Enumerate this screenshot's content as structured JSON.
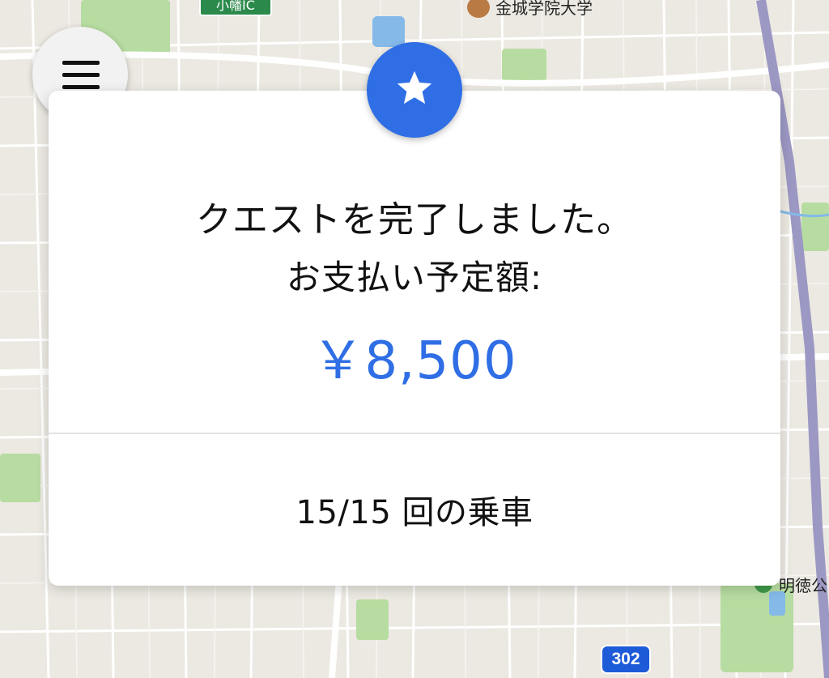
{
  "map": {
    "ic_sign": "小幡IC",
    "university_label": "金城学院大学",
    "park_label": "明徳公",
    "route_number": "302",
    "colors": {
      "land": "#ece9e2",
      "block": "#f6f3ee",
      "road": "#ffffff",
      "highway": "#9c98c4",
      "park": "#b7dca1",
      "river": "#84b9e8"
    }
  },
  "menu": {
    "icon": "hamburger-menu-icon"
  },
  "badge": {
    "icon": "star-icon",
    "color": "#2f6ee5"
  },
  "quest": {
    "title": "クエストを完了しました。",
    "payment_label": "お支払い予定額:",
    "amount": "￥8,500",
    "rides": "15/15 回の乗車"
  }
}
